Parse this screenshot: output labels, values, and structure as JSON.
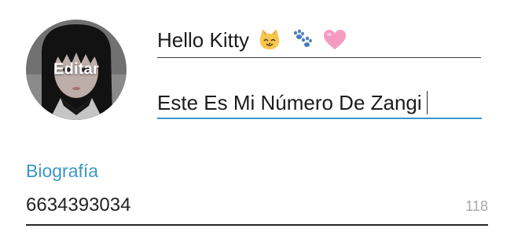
{
  "profile": {
    "avatar_action": "Editar",
    "name": "Hello Kitty",
    "name_emojis": [
      "cat-face-icon",
      "paw-prints-icon",
      "pink-heart-icon"
    ],
    "status": "Este Es Mi Número De Zangi"
  },
  "bio": {
    "label": "Biografía",
    "value": "6634393034",
    "remaining_chars": "118"
  },
  "colors": {
    "accent": "#3d95c6",
    "text": "#1c1c1c",
    "counter": "#a8a8a8"
  }
}
